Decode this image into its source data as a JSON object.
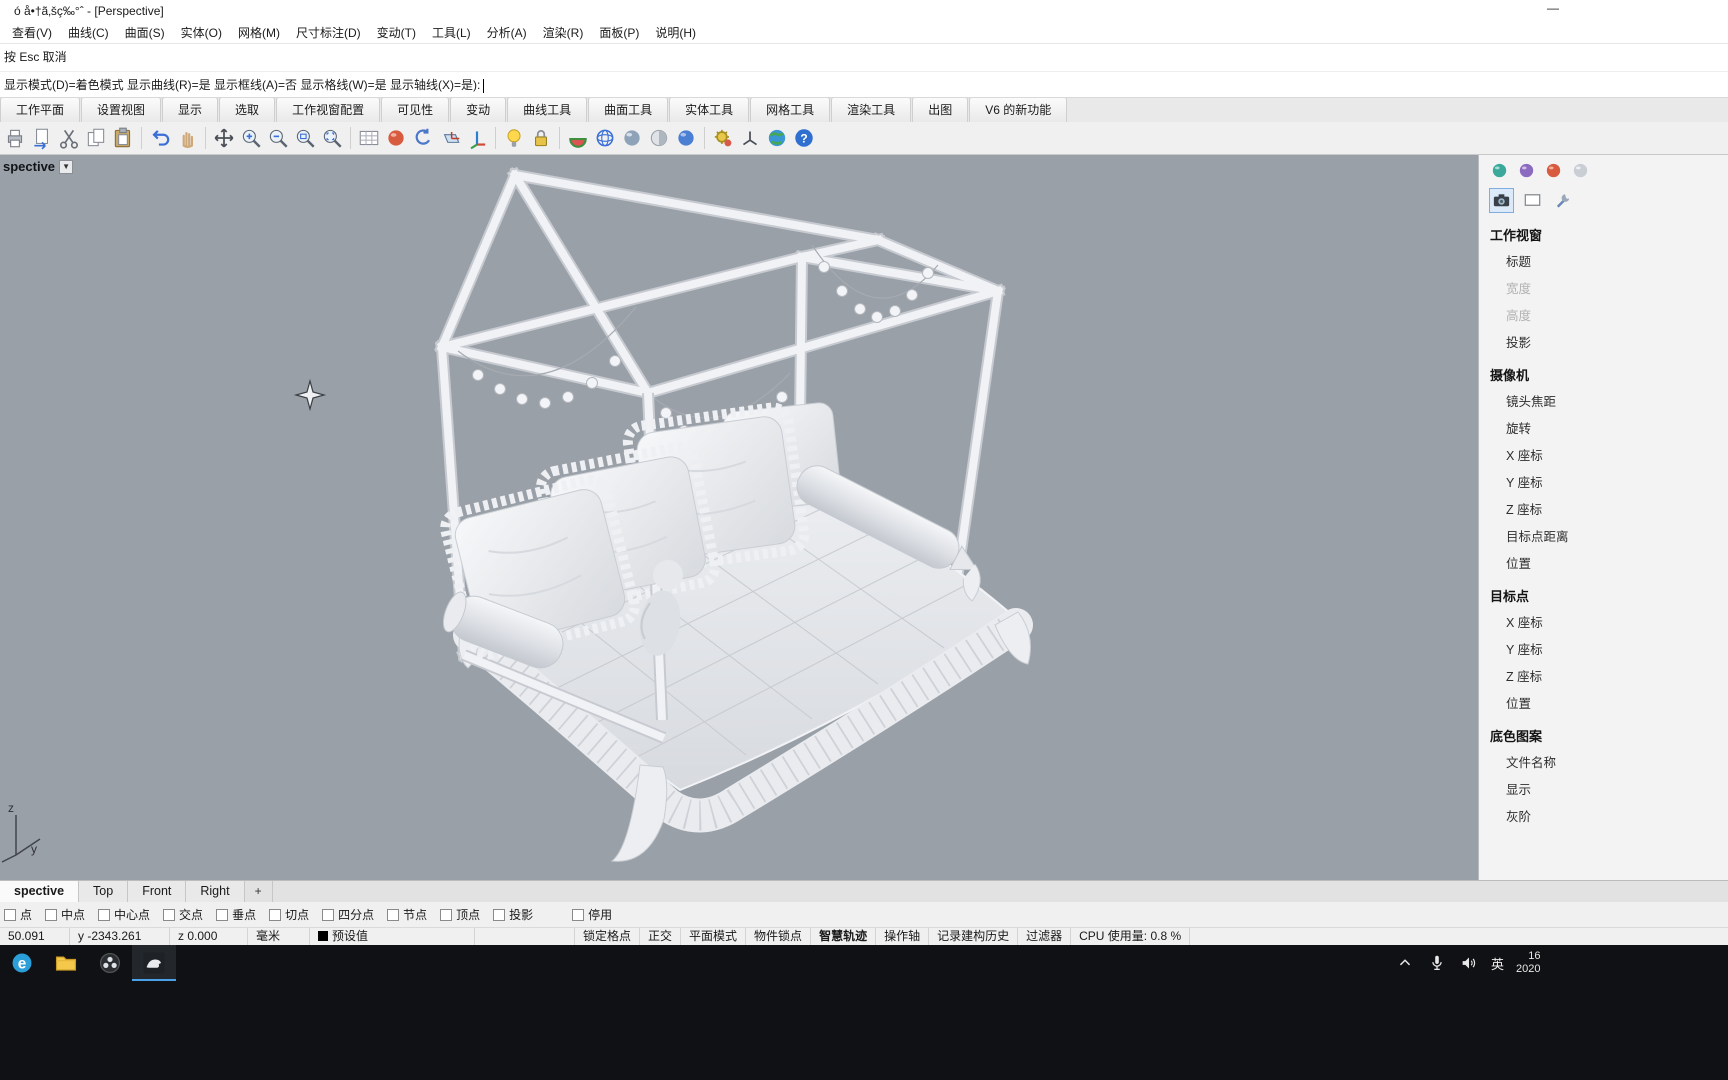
{
  "window": {
    "title": "ó å•†ã‚šç‰°ˆ - [Perspective]",
    "minimize_glyph": "—"
  },
  "menu": {
    "items": [
      "查看(V)",
      "曲线(C)",
      "曲面(S)",
      "实体(O)",
      "网格(M)",
      "尺寸标注(D)",
      "变动(T)",
      "工具(L)",
      "分析(A)",
      "渲染(R)",
      "面板(P)",
      "说明(H)"
    ]
  },
  "command": {
    "history_line": "按 Esc 取消",
    "prompt_line": "显示模式(D)=着色模式  显示曲线(R)=是  显示框线(A)=否  显示格线(W)=是  显示轴线(X)=是):"
  },
  "ribbon_tabs": [
    "工作平面",
    "设置视图",
    "显示",
    "选取",
    "工作视窗配置",
    "可见性",
    "变动",
    "曲线工具",
    "曲面工具",
    "实体工具",
    "网格工具",
    "渲染工具",
    "出图",
    "V6 的新功能"
  ],
  "toolbar": {
    "icons": [
      "print",
      "export",
      "cut",
      "copy",
      "paste",
      "|",
      "undo",
      "pan",
      "|",
      "move",
      "zoom-in",
      "zoom-out",
      "zoom-window",
      "zoom-extents",
      "|",
      "grid",
      "render-red",
      "rotate-view",
      "cplane",
      "gumball-axis",
      "|",
      "bulb",
      "lock",
      "|",
      "material",
      "wireframe",
      "shaded",
      "ghosted",
      "rendered",
      "|",
      "gear",
      "axis",
      "earth",
      "help"
    ]
  },
  "viewport": {
    "label": "spective",
    "dropdown_glyph": "▼",
    "background": "#9aa0a8",
    "scene_description": "white house-frame canopy bed with quilted mattress, ruffled pillows, bolsters and string lights",
    "axis_labels": {
      "z": "z",
      "y": "y"
    }
  },
  "right_panel": {
    "tab_icons_row1": [
      "ball-teal",
      "ball-purple",
      "ball-red",
      "ball-gray"
    ],
    "tab_icons_row2": [
      "camera",
      "display",
      "wrench"
    ],
    "selected_tool": "camera",
    "sections": [
      {
        "title": "工作视窗",
        "items": [
          {
            "label": "标题"
          },
          {
            "label": "宽度",
            "disabled": true
          },
          {
            "label": "高度",
            "disabled": true
          },
          {
            "label": "投影"
          }
        ]
      },
      {
        "title": "摄像机",
        "items": [
          {
            "label": "镜头焦距"
          },
          {
            "label": "旋转"
          },
          {
            "label": "X 座标"
          },
          {
            "label": "Y 座标"
          },
          {
            "label": "Z 座标"
          },
          {
            "label": "目标点距离"
          },
          {
            "label": "位置"
          }
        ]
      },
      {
        "title": "目标点",
        "items": [
          {
            "label": "X 座标"
          },
          {
            "label": "Y 座标"
          },
          {
            "label": "Z 座标"
          },
          {
            "label": "位置"
          }
        ]
      },
      {
        "title": "底色图案",
        "items": [
          {
            "label": "文件名称"
          },
          {
            "label": "显示"
          },
          {
            "label": "灰阶"
          }
        ]
      }
    ]
  },
  "view_tabs": {
    "tabs": [
      "spective",
      "Top",
      "Front",
      "Right"
    ],
    "active": "spective",
    "add_label": "+"
  },
  "osnap": {
    "items": [
      "点",
      "中点",
      "中心点",
      "交点",
      "垂点",
      "切点",
      "四分点",
      "节点",
      "顶点",
      "投影"
    ],
    "disable_label": "停用"
  },
  "status": {
    "coord_x": "50.091",
    "coord_y": "y -2343.261",
    "coord_z": "z 0.000",
    "units": "毫米",
    "layer": "预设值",
    "layer_swatch": "#000000",
    "buttons": [
      "锁定格点",
      "正交",
      "平面模式",
      "物件锁点",
      "智慧轨迹",
      "操作轴",
      "记录建构历史",
      "过滤器"
    ],
    "active_buttons": [
      "智慧轨迹"
    ],
    "cpu": "CPU 使用量: 0.8 %"
  },
  "taskbar": {
    "app_icons": [
      "edge",
      "explorer",
      "obs",
      "rhino"
    ],
    "active_app": "rhino",
    "tray": {
      "icons": [
        "chevron-up",
        "mic",
        "speaker"
      ],
      "ime": "英",
      "clock_time": "16",
      "clock_date": "2020"
    }
  }
}
